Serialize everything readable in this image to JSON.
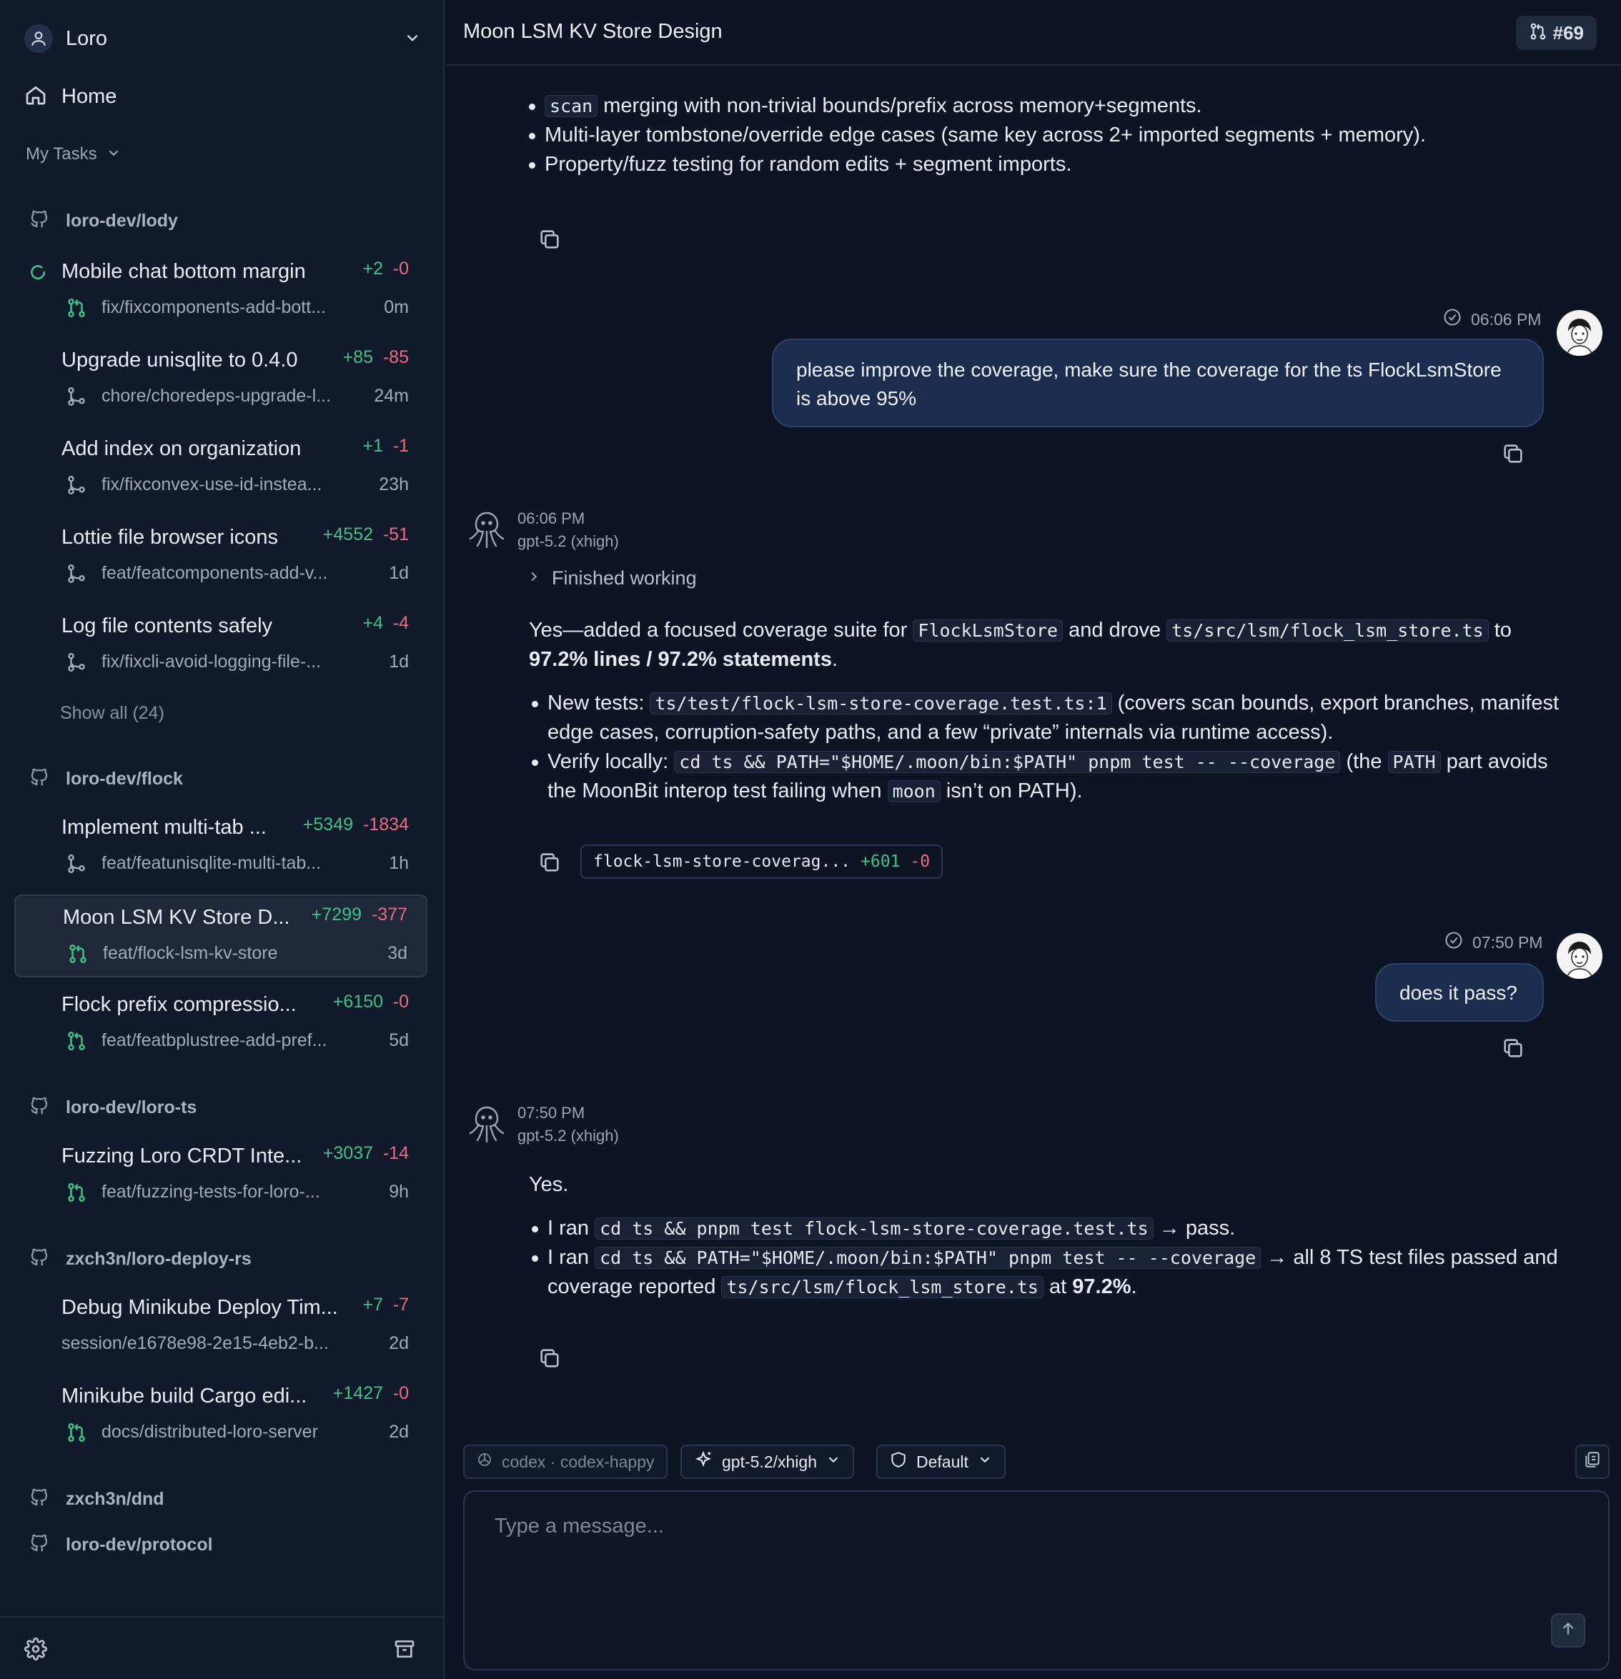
{
  "sidebar": {
    "workspace": "Loro",
    "home": "Home",
    "my_tasks": "My Tasks",
    "show_all": "Show all (24)",
    "repos": [
      {
        "name": "loro-dev/lody"
      },
      {
        "name": "loro-dev/flock"
      },
      {
        "name": "loro-dev/loro-ts"
      },
      {
        "name": "zxch3n/loro-deploy-rs"
      },
      {
        "name": "zxch3n/dnd"
      },
      {
        "name": "loro-dev/protocol"
      }
    ],
    "tasks": [
      {
        "title": "Mobile chat bottom margin",
        "adds": "+2",
        "dels": "-0",
        "branch": "fix/fixcomponents-add-bott...",
        "age": "0m",
        "icon": "pull-request-icon",
        "status": "running"
      },
      {
        "title": "Upgrade unisqlite to 0.4.0",
        "adds": "+85",
        "dels": "-85",
        "branch": "chore/choredeps-upgrade-l...",
        "age": "24m",
        "icon": "branch-icon"
      },
      {
        "title": "Add index on organization",
        "adds": "+1",
        "dels": "-1",
        "branch": "fix/fixconvex-use-id-instea...",
        "age": "23h",
        "icon": "branch-icon"
      },
      {
        "title": "Lottie file browser icons",
        "adds": "+4552",
        "dels": "-51",
        "branch": "feat/featcomponents-add-v...",
        "age": "1d",
        "icon": "branch-icon"
      },
      {
        "title": "Log file contents safely",
        "adds": "+4",
        "dels": "-4",
        "branch": "fix/fixcli-avoid-logging-file-...",
        "age": "1d",
        "icon": "branch-icon"
      },
      {
        "title": "Implement multi-tab ...",
        "adds": "+5349",
        "dels": "-1834",
        "branch": "feat/featunisqlite-multi-tab...",
        "age": "1h",
        "icon": "branch-icon"
      },
      {
        "title": "Moon LSM KV Store D...",
        "adds": "+7299",
        "dels": "-377",
        "branch": "feat/flock-lsm-kv-store",
        "age": "3d",
        "icon": "pull-request-icon",
        "active": true
      },
      {
        "title": "Flock prefix compressio...",
        "adds": "+6150",
        "dels": "-0",
        "branch": "feat/featbplustree-add-pref...",
        "age": "5d",
        "icon": "pull-request-icon"
      },
      {
        "title": "Fuzzing Loro CRDT Inte...",
        "adds": "+3037",
        "dels": "-14",
        "branch": "feat/fuzzing-tests-for-loro-...",
        "age": "9h",
        "icon": "pull-request-icon"
      },
      {
        "title": "Debug Minikube Deploy Tim...",
        "adds": "+7",
        "dels": "-7",
        "branch": "session/e1678e98-2e15-4eb2-b...",
        "age": "2d",
        "icon": "none"
      },
      {
        "title": "Minikube build Cargo edi...",
        "adds": "+1427",
        "dels": "-0",
        "branch": "docs/distributed-loro-server",
        "age": "2d",
        "icon": "pull-request-icon"
      }
    ]
  },
  "header": {
    "title": "Moon LSM KV Store Design",
    "pr_number": "#69"
  },
  "conversation": {
    "prev_bullets": [
      {
        "code": "scan",
        "text": " merging with non-trivial bounds/prefix across memory+segments."
      },
      {
        "text": "Multi-layer tombstone/override edge cases (same key across 2+ imported segments + memory)."
      },
      {
        "text": "Property/fuzz testing for random edits + segment imports."
      }
    ],
    "user1": {
      "time": "06:06 PM",
      "text": "please improve the coverage, make sure the coverage for the ts FlockLsmStore is above 95%"
    },
    "bot1": {
      "time": "06:06 PM",
      "model": "gpt-5.2 (xhigh)",
      "finished": "Finished working",
      "p1": "Yes—added a focused coverage suite for ",
      "p1_code1": "FlockLsmStore",
      "p1_mid": " and drove ",
      "p1_code2": "ts/src/lsm/flock_lsm_store.ts",
      "p1_to": " to ",
      "p1_bold": "97.2% lines / 97.2% statements",
      "p1_end": ".",
      "b1_lead": "New tests: ",
      "b1_code": "ts/test/flock-lsm-store-coverage.test.ts:1",
      "b1_rest": " (covers scan bounds, export branches, manifest edge cases, corruption-safety paths, and a few “private” internals via runtime access).",
      "b2_lead": "Verify locally: ",
      "b2_code": "cd ts && PATH=\"$HOME/.moon/bin:$PATH\" pnpm test -- --coverage",
      "b2_mid": " (the ",
      "b2_code2": "PATH",
      "b2_mid2": " part avoids the MoonBit interop test failing when ",
      "b2_code3": "moon",
      "b2_end": " isn’t on PATH).",
      "file": {
        "name": "flock-lsm-store-coverag...",
        "adds": "+601",
        "dels": "-0"
      }
    },
    "user2": {
      "time": "07:50 PM",
      "text": "does it pass?"
    },
    "bot2": {
      "time": "07:50 PM",
      "model": "gpt-5.2 (xhigh)",
      "p1": "Yes.",
      "b1_lead": "I ran ",
      "b1_code": "cd ts && pnpm test flock-lsm-store-coverage.test.ts",
      "b1_rest": " → pass.",
      "b2_lead": "I ran ",
      "b2_code": "cd ts && PATH=\"$HOME/.moon/bin:$PATH\" pnpm test -- --coverage",
      "b2_mid": " → all 8 TS test files passed and coverage reported ",
      "b2_code2": "ts/src/lsm/flock_lsm_store.ts",
      "b2_at": " at ",
      "b2_bold": "97.2%",
      "b2_end": "."
    }
  },
  "composer": {
    "agent": "codex · codex-happy",
    "model": "gpt-5.2/xhigh",
    "permission": "Default",
    "placeholder": "Type a message..."
  },
  "colors": {
    "add": "#3fc28a",
    "del": "#ef6b7e",
    "bubble": "#1b2c4f",
    "background": "#0d1424"
  }
}
